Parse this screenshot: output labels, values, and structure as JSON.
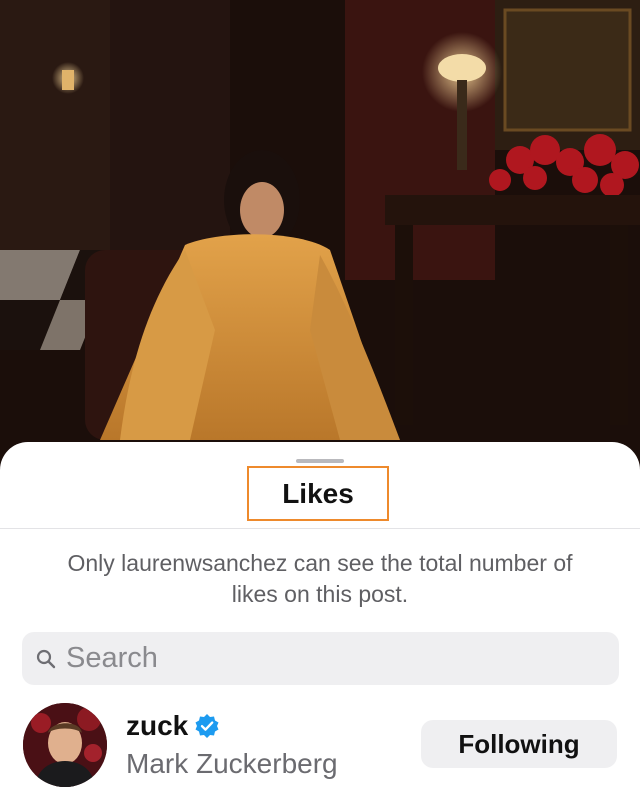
{
  "sheet": {
    "title": "Likes",
    "notice": "Only laurenwsanchez can see the total number of likes on this post."
  },
  "search": {
    "placeholder": "Search",
    "icon": "search-icon"
  },
  "likes_list": [
    {
      "username": "zuck",
      "full_name": "Mark Zuckerberg",
      "verified": true,
      "button_label": "Following"
    }
  ],
  "colors": {
    "highlight_border": "#ee8a2c",
    "verified_badge": "#1d9bf0",
    "search_bg": "#efeff1",
    "secondary_text": "#6b6b70"
  }
}
